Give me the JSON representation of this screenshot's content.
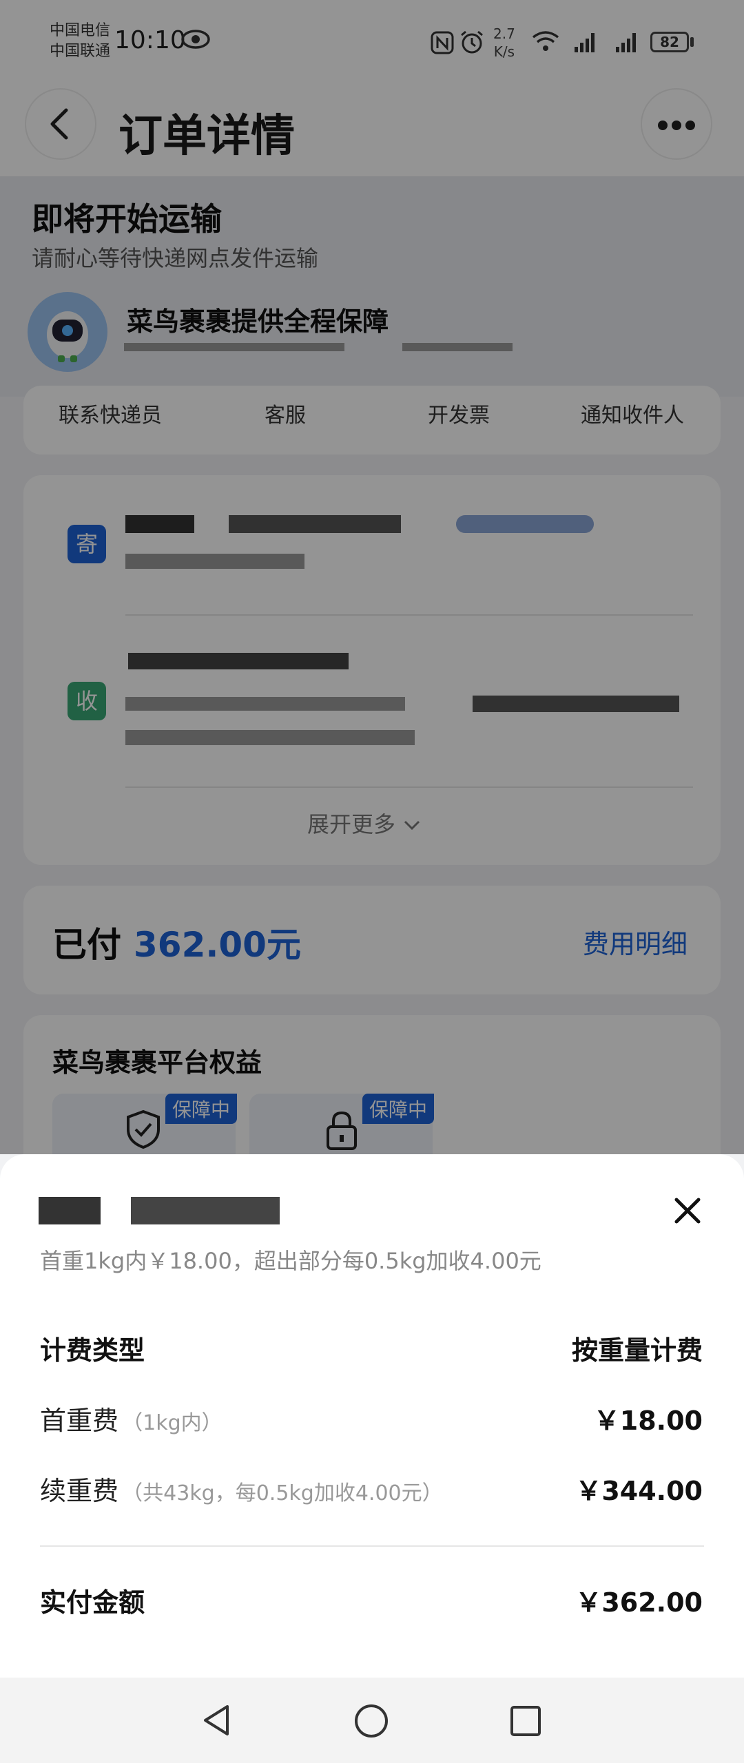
{
  "status_bar": {
    "carrier_1": "中国电信",
    "carrier_2": "中国联通",
    "time": "10:10",
    "speed_value": "2.7",
    "speed_unit": "K/s",
    "battery": "82"
  },
  "header": {
    "title": "订单详情"
  },
  "shipping": {
    "status_title": "即将开始运输",
    "status_sub": "请耐心等待快递网点发件运输",
    "guarantee": "菜鸟裹裹提供全程保障"
  },
  "actions": [
    "联系快递员",
    "客服",
    "开发票",
    "通知收件人"
  ],
  "address": {
    "sender_tag": "寄",
    "receiver_tag": "收",
    "expand": "展开更多"
  },
  "payment": {
    "label": "已付",
    "amount": "362.00元",
    "detail_link": "费用明细"
  },
  "benefits": {
    "title": "菜鸟裹裹平台权益",
    "badge": "保障中"
  },
  "sheet": {
    "desc": "首重1kg内￥18.00，超出部分每0.5kg加收4.00元",
    "billing_type_label": "计费类型",
    "billing_type_value": "按重量计费",
    "first_weight_label": "首重费",
    "first_weight_note": "（1kg内）",
    "first_weight_value": "￥18.00",
    "continued_label": "续重费",
    "continued_note": "（共43kg，每0.5kg加收4.00元）",
    "continued_value": "￥344.00",
    "total_label": "实付金额",
    "total_value": "￥362.00"
  },
  "colors": {
    "accent": "#1e63d6",
    "sender_tag": "#1e63d6",
    "receiver_tag": "#3aa876"
  }
}
